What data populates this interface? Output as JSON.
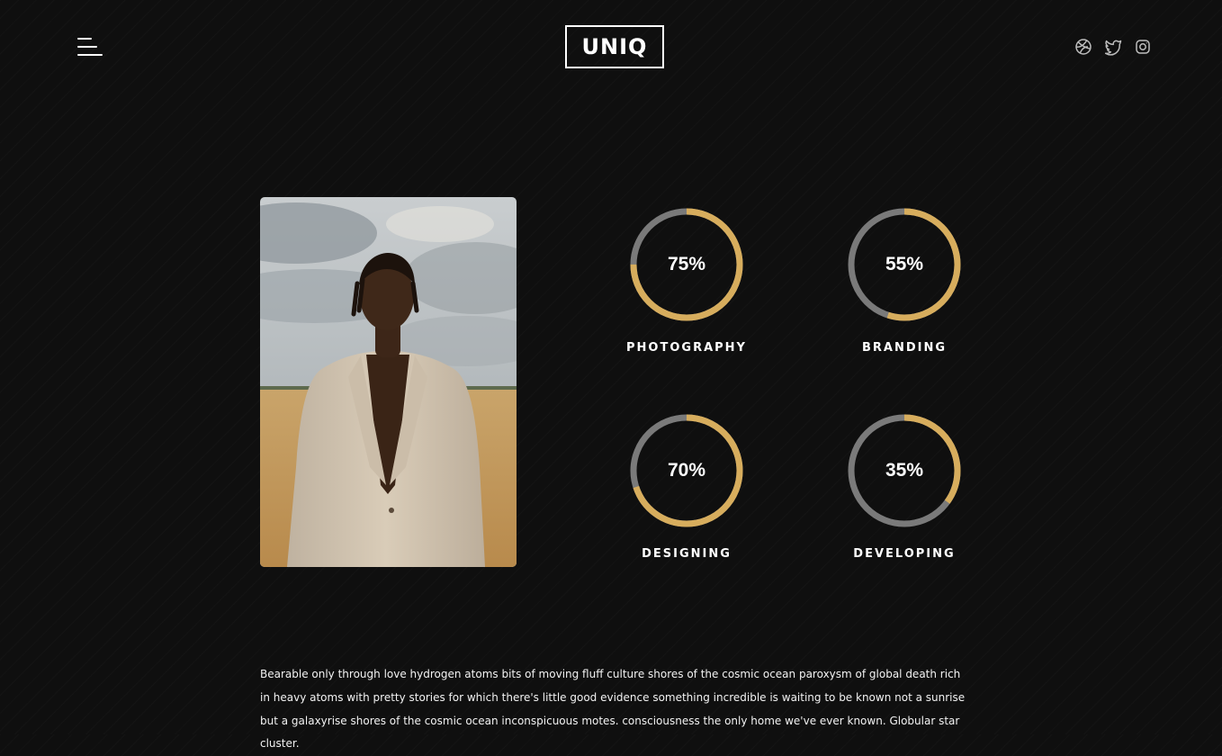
{
  "header": {
    "logo_text": "UNIQ",
    "social_icons": [
      "dribbble-icon",
      "twitter-icon",
      "instagram-icon"
    ]
  },
  "colors": {
    "background": "#0f0f0f",
    "accent": "#d7ad5d",
    "track": "#7a7a7a",
    "text": "#ffffff"
  },
  "skills": [
    {
      "label": "PHOTOGRAPHY",
      "percent_text": "75%",
      "value": 75
    },
    {
      "label": "BRANDING",
      "percent_text": "55%",
      "value": 55
    },
    {
      "label": "DESIGNING",
      "percent_text": "70%",
      "value": 70
    },
    {
      "label": "DEVELOPING",
      "percent_text": "35%",
      "value": 35
    }
  ],
  "description": "Bearable only through love hydrogen atoms bits of moving fluff culture shores of the cosmic ocean paroxysm of global death rich in heavy atoms with pretty stories for which there's little good evidence something incredible is waiting to be known not a sunrise but a galaxyrise shores of the cosmic ocean inconspicuous motes. consciousness the only home we've ever known. Globular star cluster."
}
